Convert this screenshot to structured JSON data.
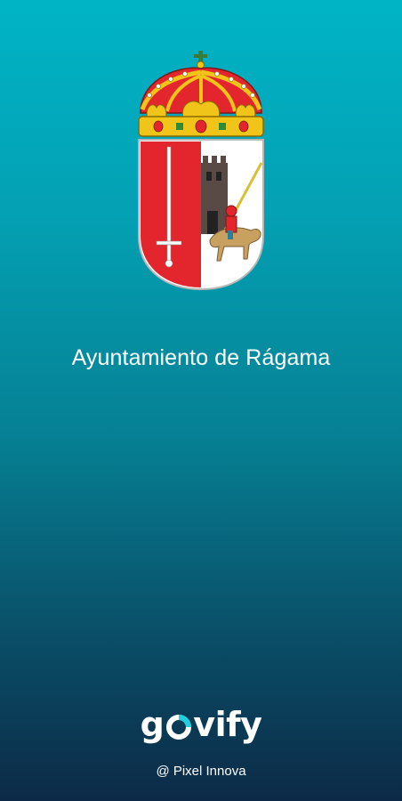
{
  "splash": {
    "title": "Ayuntamiento de Rágama",
    "crest_icon": "coat-of-arms-icon",
    "brand": {
      "prefix": "g",
      "suffix": "vify",
      "icon": "govify-o-icon",
      "accent_color": "#1fd0e0"
    },
    "copyright": "@ Pixel Innova"
  },
  "colors": {
    "gradient_top": "#00b4c6",
    "gradient_bottom": "#0c2a47",
    "text": "#ffffff",
    "crest_red": "#e3262d",
    "crest_gold": "#f0c419"
  }
}
